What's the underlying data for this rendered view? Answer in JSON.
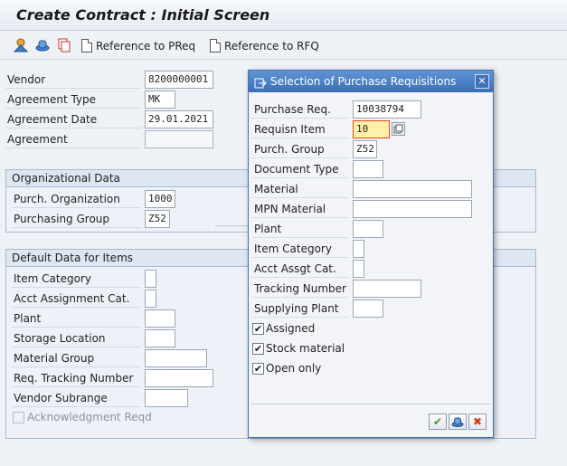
{
  "title": "Create Contract : Initial Screen",
  "toolbar": {
    "ref_preq_label": "Reference to PReq",
    "ref_rfq_label": "Reference to RFQ"
  },
  "header_fields": {
    "vendor": {
      "label": "Vendor",
      "value": "8200000001"
    },
    "agreement_type": {
      "label": "Agreement Type",
      "value": "MK"
    },
    "agreement_date": {
      "label": "Agreement Date",
      "value": "29.01.2021"
    },
    "agreement": {
      "label": "Agreement",
      "value": ""
    }
  },
  "org_data": {
    "title": "Organizational Data",
    "purch_org": {
      "label": "Purch. Organization",
      "value": "1000"
    },
    "purch_group": {
      "label": "Purchasing Group",
      "value": "Z52"
    }
  },
  "default_data": {
    "title": "Default Data for Items",
    "fields": [
      {
        "label": "Item Category",
        "value": ""
      },
      {
        "label": "Acct Assignment Cat.",
        "value": ""
      },
      {
        "label": "Plant",
        "value": ""
      },
      {
        "label": "Storage Location",
        "value": ""
      },
      {
        "label": "Material Group",
        "value": ""
      },
      {
        "label": "Req. Tracking Number",
        "value": ""
      },
      {
        "label": "Vendor Subrange",
        "value": ""
      }
    ],
    "ack_label": "Acknowledgment Reqd"
  },
  "dialog": {
    "title": "Selection of Purchase Requisitions",
    "close_glyph": "✕",
    "fields": [
      {
        "label": "Purchase Req.",
        "value": "10038794"
      },
      {
        "label": "Requisn Item",
        "value": "10"
      },
      {
        "label": "Purch. Group",
        "value": "Z52"
      },
      {
        "label": "Document Type",
        "value": ""
      },
      {
        "label": "Material",
        "value": ""
      },
      {
        "label": "MPN Material",
        "value": ""
      },
      {
        "label": "Plant",
        "value": ""
      },
      {
        "label": "Item Category",
        "value": ""
      },
      {
        "label": "Acct Assgt Cat.",
        "value": ""
      },
      {
        "label": "Tracking Number",
        "value": ""
      },
      {
        "label": "Supplying Plant",
        "value": ""
      }
    ],
    "checkboxes": [
      {
        "label": "Assigned",
        "checked": true
      },
      {
        "label": "Stock material",
        "checked": true
      },
      {
        "label": "Open only",
        "checked": true
      }
    ],
    "check_glyph": "✔",
    "buttons": {
      "ok_glyph": "✔",
      "cancel_glyph": "✖"
    }
  },
  "colors": {
    "ok": "#3a9a2a",
    "cancel": "#d23a1a",
    "active_field": "#fff2a8",
    "focus_border": "#e04a1a"
  },
  "icons": [
    "display-change-icon",
    "other-document-icon",
    "copy-icon",
    "document-icon",
    "document-icon",
    "dialog-title-icon",
    "close-icon",
    "multi-select-icon",
    "check-icon",
    "hat-icon",
    "cancel-icon"
  ]
}
